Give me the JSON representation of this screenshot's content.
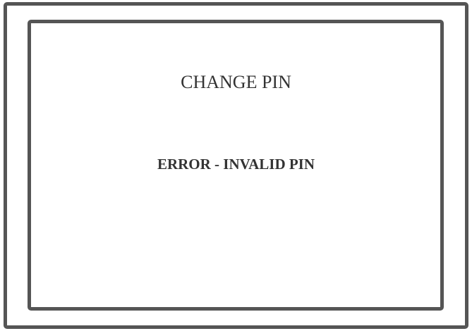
{
  "screen": {
    "title": "CHANGE PIN",
    "message": "ERROR - INVALID PIN",
    "frame_color": "#555555"
  }
}
